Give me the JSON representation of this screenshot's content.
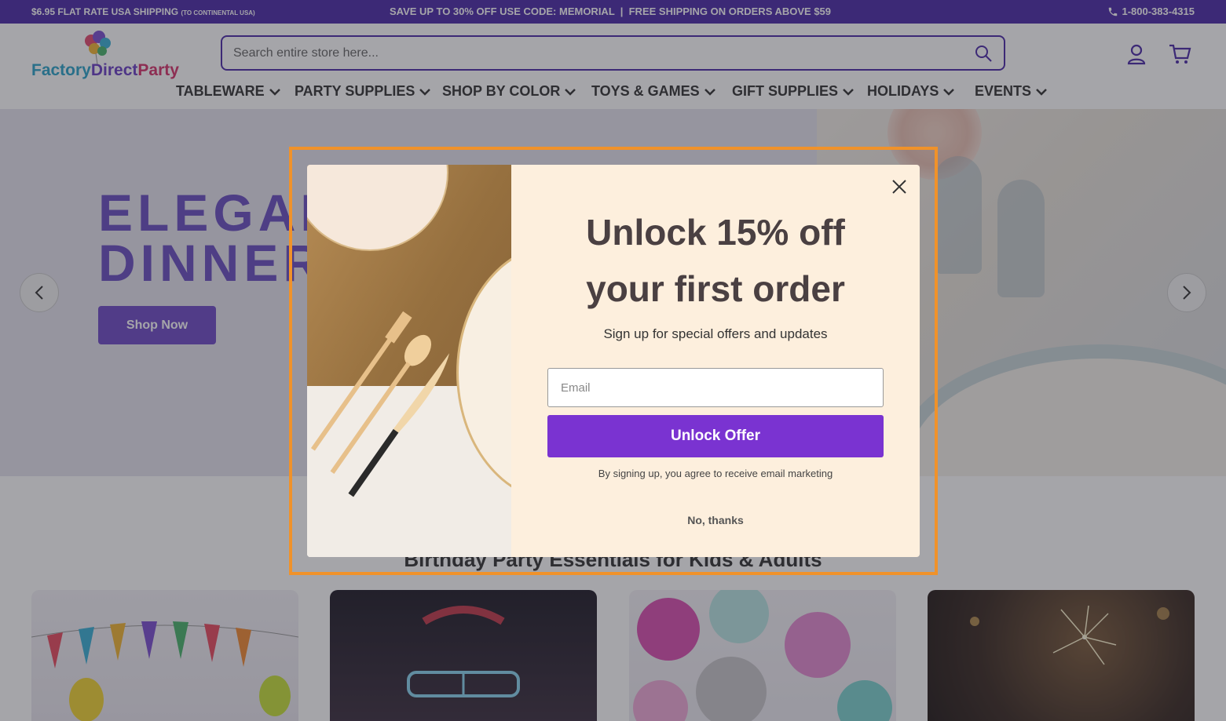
{
  "topbar": {
    "shipping": "$6.95 FLAT RATE USA SHIPPING",
    "shipping_note": "(TO CONTINENTAL USA)",
    "promo": "SAVE UP TO 30% OFF USE CODE: MEMORIAL  |  FREE SHIPPING ON ORDERS ABOVE $59",
    "phone": "1-800-383-4315",
    "phone_icon": "phone-icon"
  },
  "header": {
    "logo": {
      "word1": "Factory",
      "word2": "Direct",
      "word3": "Party"
    },
    "search_placeholder": "Search entire store here...",
    "search_icon": "search-icon",
    "account_icon": "account-icon",
    "cart_icon": "cart-icon"
  },
  "nav": {
    "items": [
      {
        "label": "TABLEWARE"
      },
      {
        "label": "PARTY SUPPLIES"
      },
      {
        "label": "SHOP BY COLOR"
      },
      {
        "label": "TOYS & GAMES"
      },
      {
        "label": "GIFT SUPPLIES"
      },
      {
        "label": "HOLIDAYS"
      },
      {
        "label": "EVENTS"
      }
    ]
  },
  "hero": {
    "title_line1": "ELEGAN",
    "title_line2": "DINNER",
    "cta": "Shop Now"
  },
  "section": {
    "title": "Birthday Party Essentials for Kids & Adults"
  },
  "modal": {
    "title_line1": "Unlock 15% off",
    "title_line2": "your first order",
    "subtitle": "Sign up for special offers and updates",
    "email_placeholder": "Email",
    "button": "Unlock Offer",
    "legal": "By signing up, you agree to receive email marketing",
    "decline": "No, thanks"
  },
  "colors": {
    "brand_purple": "#4b2aa8",
    "cta_purple": "#7a33d1",
    "modal_bg": "#fdefdd",
    "highlight_border": "#f0922a"
  }
}
